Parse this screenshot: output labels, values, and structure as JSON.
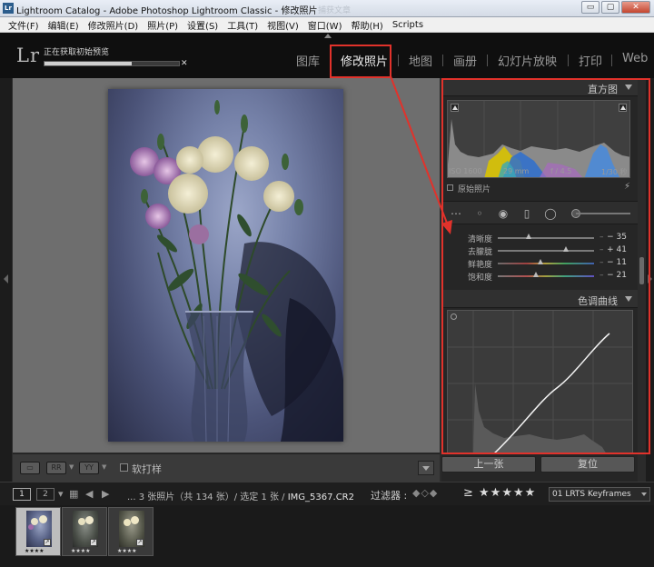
{
  "window": {
    "app_icon": "Lr",
    "title": "Lightroom Catalog - Adobe Photoshop Lightroom Classic - 修改照片",
    "ghost_text": "捕获文章",
    "buttons": {
      "minimize": "▭",
      "maximize": "▢",
      "close": "✕"
    }
  },
  "menu": [
    "文件(F)",
    "编辑(E)",
    "修改照片(D)",
    "照片(P)",
    "设置(S)",
    "工具(T)",
    "视图(V)",
    "窗口(W)",
    "帮助(H)",
    "Scripts"
  ],
  "header": {
    "logo": "Lr",
    "status_text": "正在获取初始预览",
    "progress": 0.65,
    "progress_close": "✕",
    "modules": [
      "图库",
      "修改照片",
      "地图",
      "画册",
      "幻灯片放映",
      "打印",
      "Web"
    ],
    "active_module": "修改照片"
  },
  "toolbar": {
    "view_buttons": [
      "▭",
      "RR",
      "YY"
    ],
    "checkbox_label": "软打样"
  },
  "histogram": {
    "title": "直方图",
    "iso": "ISO 1600",
    "focal": "29 mm",
    "aperture": "f / 4.5",
    "shutter": "1/30 秒",
    "original_label": "原始照片"
  },
  "basic": {
    "sliders": [
      {
        "label": "清晰度",
        "value": "− 35",
        "amount": -35
      },
      {
        "label": "去朦胧",
        "value": "+ 41",
        "amount": 41
      },
      {
        "label": "鲜艳度",
        "value": "− 11",
        "amount": -11
      },
      {
        "label": "饱和度",
        "value": "− 21",
        "amount": -21
      }
    ]
  },
  "tone_curve": {
    "title": "色调曲线"
  },
  "bottom_buttons": {
    "previous": "上一张",
    "reset": "复位"
  },
  "filmbar": {
    "screen1": "1",
    "screen2": "2",
    "crumb_prefix": "...",
    "crumb_count": "3 张照片（共 134 张）/ 选定 1 张 /",
    "crumb_file": "IMG_5367.CR2",
    "filter_label": "过滤器 :",
    "rating": "≥ ★★★★★",
    "preset": "01 LRTS Keyframes"
  },
  "filmstrip": {
    "thumbnails": [
      {
        "stars": "★★★★",
        "selected": true
      },
      {
        "stars": "★★★★",
        "selected": false
      },
      {
        "stars": "★★★★",
        "selected": false
      }
    ]
  },
  "colors": {
    "annotation_red": "#e1322b",
    "panel_bg": "#262626",
    "app_bg": "#1e1e1e"
  }
}
